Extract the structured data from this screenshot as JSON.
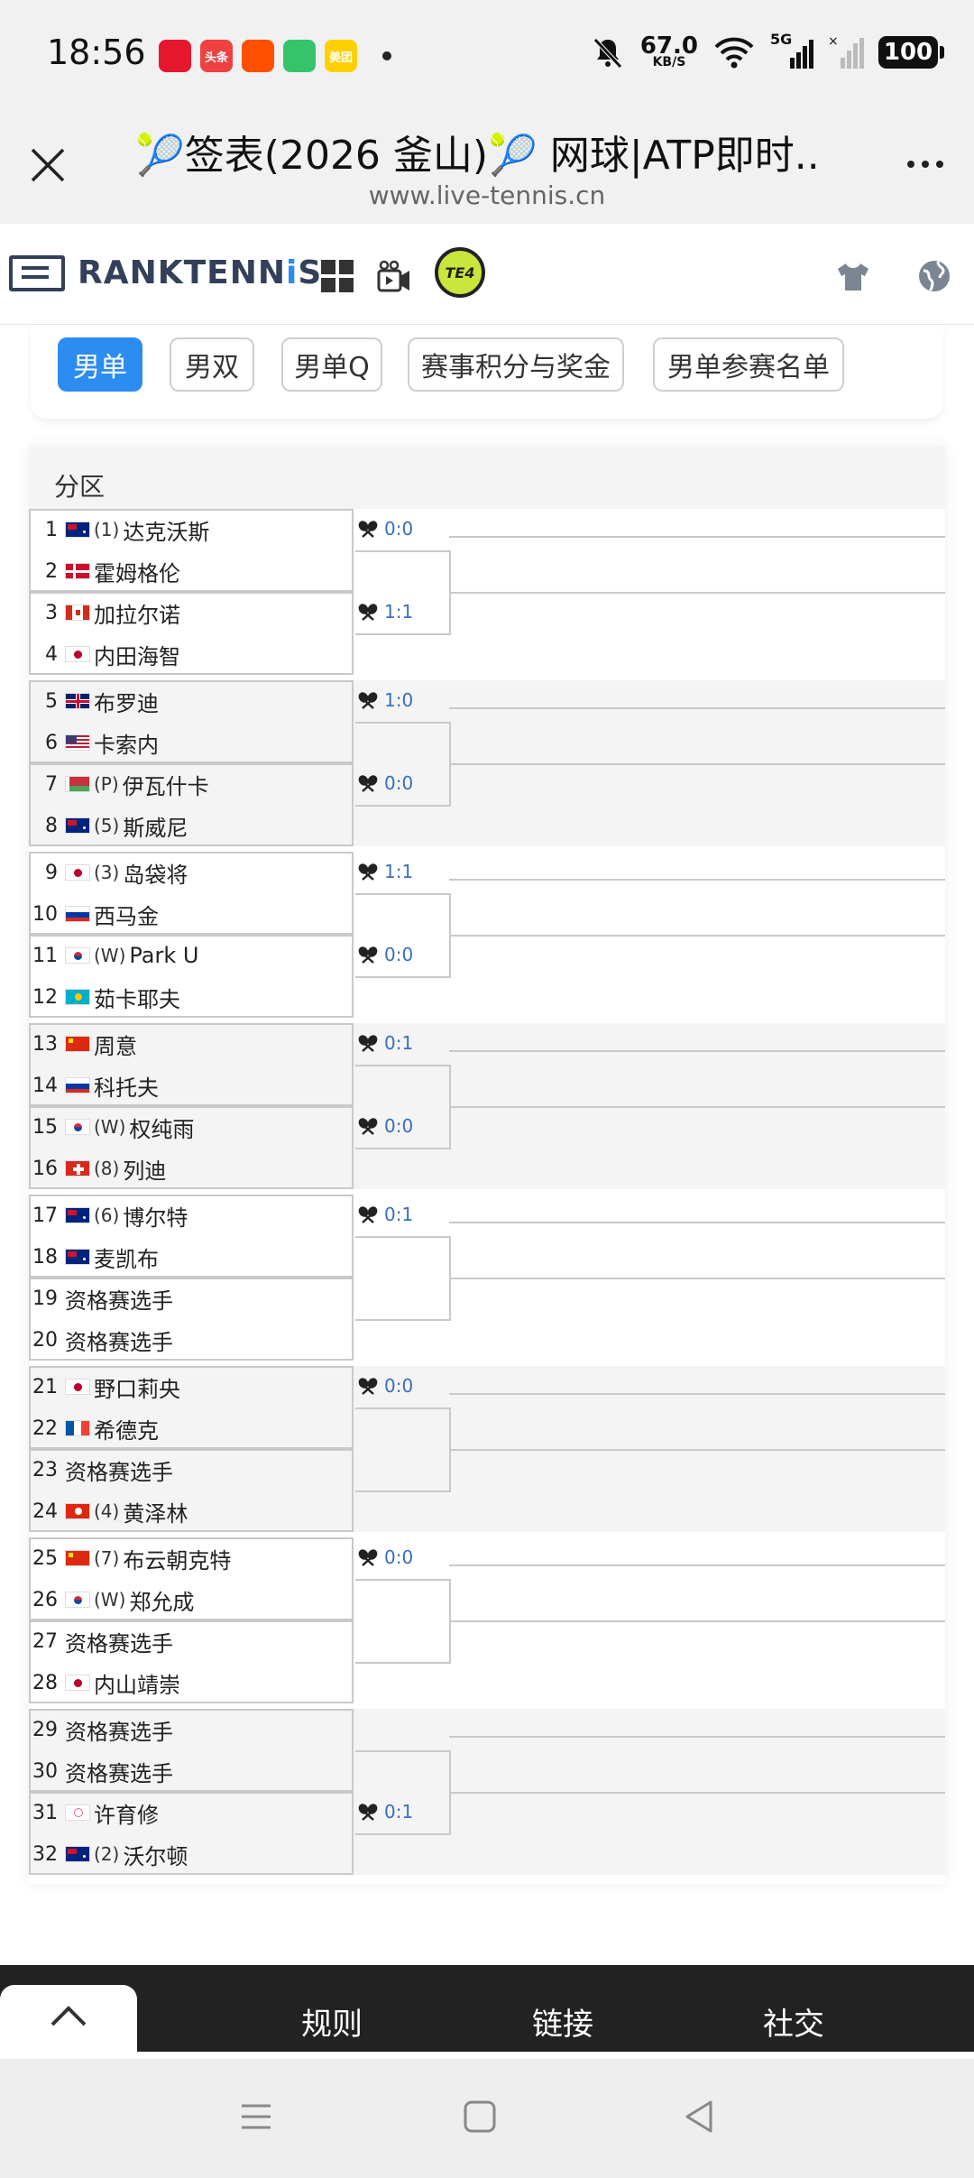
{
  "status_bar": {
    "time": "18:56",
    "apps": [
      {
        "name": "weibo-app-icon",
        "label": "",
        "color": "#e6162d"
      },
      {
        "name": "toutiao-app-icon",
        "label": "头条",
        "color": "#f04142"
      },
      {
        "name": "taobao-app-icon",
        "label": "",
        "color": "#ff5000"
      },
      {
        "name": "battery-app-icon",
        "label": "",
        "color": "#36c36b"
      },
      {
        "name": "meituan-app-icon",
        "label": "美团",
        "color": "#ffd000"
      }
    ],
    "net_speed": "67.0",
    "net_unit": "KB/S",
    "network": "5G",
    "battery": "100"
  },
  "browser": {
    "title": "🎾签表(2026 釜山)🎾 网球|ATP即时...",
    "url": "www.live-tennis.cn"
  },
  "site": {
    "logo_text_a": "RANKTENN",
    "logo_text_b": "i",
    "logo_text_c": "S",
    "t24": "TE4"
  },
  "tabs": [
    {
      "label": "男单",
      "active": true
    },
    {
      "label": "男双",
      "active": false
    },
    {
      "label": "男单Q",
      "active": false
    },
    {
      "label": "赛事积分与奖金",
      "active": false
    },
    {
      "label": "男单参赛名单",
      "active": false
    }
  ],
  "draw": {
    "section_label": "分区",
    "players": [
      {
        "num": "1",
        "flag": "AUS",
        "seed": "(1)",
        "name": "达克沃斯"
      },
      {
        "num": "2",
        "flag": "DEN",
        "seed": "",
        "name": "霍姆格伦"
      },
      {
        "num": "3",
        "flag": "CAN",
        "seed": "",
        "name": "加拉尔诺"
      },
      {
        "num": "4",
        "flag": "JPN",
        "seed": "",
        "name": "内田海智"
      },
      {
        "num": "5",
        "flag": "GBR",
        "seed": "",
        "name": "布罗迪"
      },
      {
        "num": "6",
        "flag": "USA",
        "seed": "",
        "name": "卡索内"
      },
      {
        "num": "7",
        "flag": "BLR",
        "seed": "(P)",
        "name": "伊瓦什卡"
      },
      {
        "num": "8",
        "flag": "AUS",
        "seed": "(5)",
        "name": "斯威尼"
      },
      {
        "num": "9",
        "flag": "JPN",
        "seed": "(3)",
        "name": "岛袋将"
      },
      {
        "num": "10",
        "flag": "RUS",
        "seed": "",
        "name": "西马金"
      },
      {
        "num": "11",
        "flag": "KOR",
        "seed": "(W)",
        "name": "Park U"
      },
      {
        "num": "12",
        "flag": "KAZ",
        "seed": "",
        "name": "茹卡耶夫"
      },
      {
        "num": "13",
        "flag": "CHN",
        "seed": "",
        "name": "周意"
      },
      {
        "num": "14",
        "flag": "RUS",
        "seed": "",
        "name": "科托夫"
      },
      {
        "num": "15",
        "flag": "KOR",
        "seed": "(W)",
        "name": "权纯雨"
      },
      {
        "num": "16",
        "flag": "SUI",
        "seed": "(8)",
        "name": "列迪"
      },
      {
        "num": "17",
        "flag": "AUS",
        "seed": "(6)",
        "name": "博尔特"
      },
      {
        "num": "18",
        "flag": "AUS",
        "seed": "",
        "name": "麦凯布"
      },
      {
        "num": "19",
        "flag": "",
        "seed": "",
        "name": "资格赛选手"
      },
      {
        "num": "20",
        "flag": "",
        "seed": "",
        "name": "资格赛选手"
      },
      {
        "num": "21",
        "flag": "JPN",
        "seed": "",
        "name": "野口莉央"
      },
      {
        "num": "22",
        "flag": "FRA",
        "seed": "",
        "name": "希德克"
      },
      {
        "num": "23",
        "flag": "",
        "seed": "",
        "name": "资格赛选手"
      },
      {
        "num": "24",
        "flag": "HKG",
        "seed": "(4)",
        "name": "黄泽林"
      },
      {
        "num": "25",
        "flag": "CHN",
        "seed": "(7)",
        "name": "布云朝克特"
      },
      {
        "num": "26",
        "flag": "KOR",
        "seed": "(W)",
        "name": "郑允成"
      },
      {
        "num": "27",
        "flag": "",
        "seed": "",
        "name": "资格赛选手"
      },
      {
        "num": "28",
        "flag": "JPN",
        "seed": "",
        "name": "内山靖崇"
      },
      {
        "num": "29",
        "flag": "",
        "seed": "",
        "name": "资格赛选手"
      },
      {
        "num": "30",
        "flag": "",
        "seed": "",
        "name": "资格赛选手"
      },
      {
        "num": "31",
        "flag": "TPE",
        "seed": "",
        "name": "许育修"
      },
      {
        "num": "32",
        "flag": "AUS",
        "seed": "(2)",
        "name": "沃尔顿"
      }
    ],
    "h2h": [
      "0:0",
      "1:1",
      "1:0",
      "0:0",
      "1:1",
      "0:0",
      "0:1",
      "0:0",
      "0:1",
      "",
      "0:0",
      "",
      "0:0",
      "",
      "",
      "0:1"
    ]
  },
  "footer": {
    "links": [
      "规则",
      "链接",
      "社交"
    ]
  },
  "colors": {
    "accent": "#2d8cf0",
    "score": "#3a6fb8",
    "footer_bg": "#222222"
  }
}
